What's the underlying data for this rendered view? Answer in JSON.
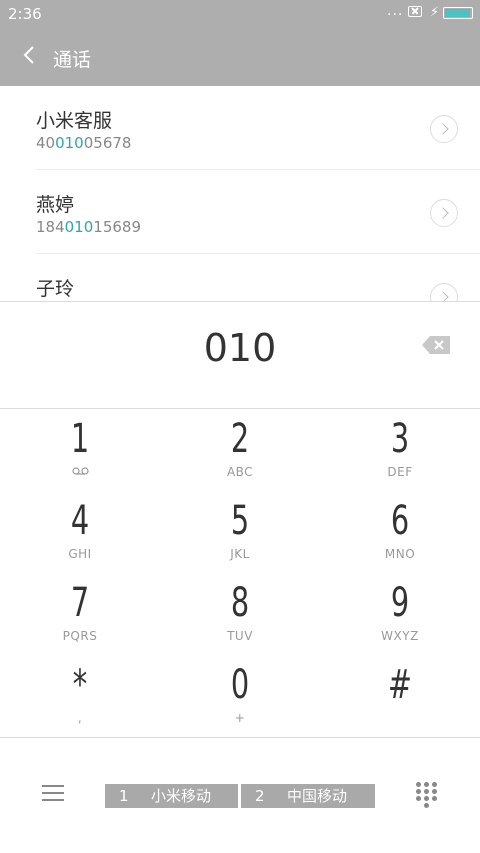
{
  "status": {
    "time": "2:36",
    "dots": "..."
  },
  "header": {
    "title": "通话"
  },
  "contacts": [
    {
      "name": "小米客服",
      "num_pre": "40",
      "num_hl": "010",
      "num_post": "05678"
    },
    {
      "name": "燕婷",
      "num_pre": "184",
      "num_hl": "010",
      "num_post": "15689"
    },
    {
      "name": "子玲",
      "num_pre": "",
      "num_hl": "",
      "num_post": ""
    }
  ],
  "dialed": "010",
  "keys": [
    {
      "digit": "1",
      "letters": ""
    },
    {
      "digit": "2",
      "letters": "ABC"
    },
    {
      "digit": "3",
      "letters": "DEF"
    },
    {
      "digit": "4",
      "letters": "GHI"
    },
    {
      "digit": "5",
      "letters": "JKL"
    },
    {
      "digit": "6",
      "letters": "MNO"
    },
    {
      "digit": "7",
      "letters": "PQRS"
    },
    {
      "digit": "8",
      "letters": "TUV"
    },
    {
      "digit": "9",
      "letters": "WXYZ"
    },
    {
      "digit": "*",
      "letters": ","
    },
    {
      "digit": "0",
      "letters": "+"
    },
    {
      "digit": "#",
      "letters": ""
    }
  ],
  "sims": [
    {
      "slot": "1",
      "carrier": "小米移动"
    },
    {
      "slot": "2",
      "carrier": "中国移动"
    }
  ],
  "icons": [
    "back-icon",
    "wifi-off-icon",
    "charging-icon",
    "battery-icon",
    "chevron-right-icon",
    "backspace-icon",
    "voicemail-icon",
    "menu-icon",
    "dialpad-icon"
  ]
}
